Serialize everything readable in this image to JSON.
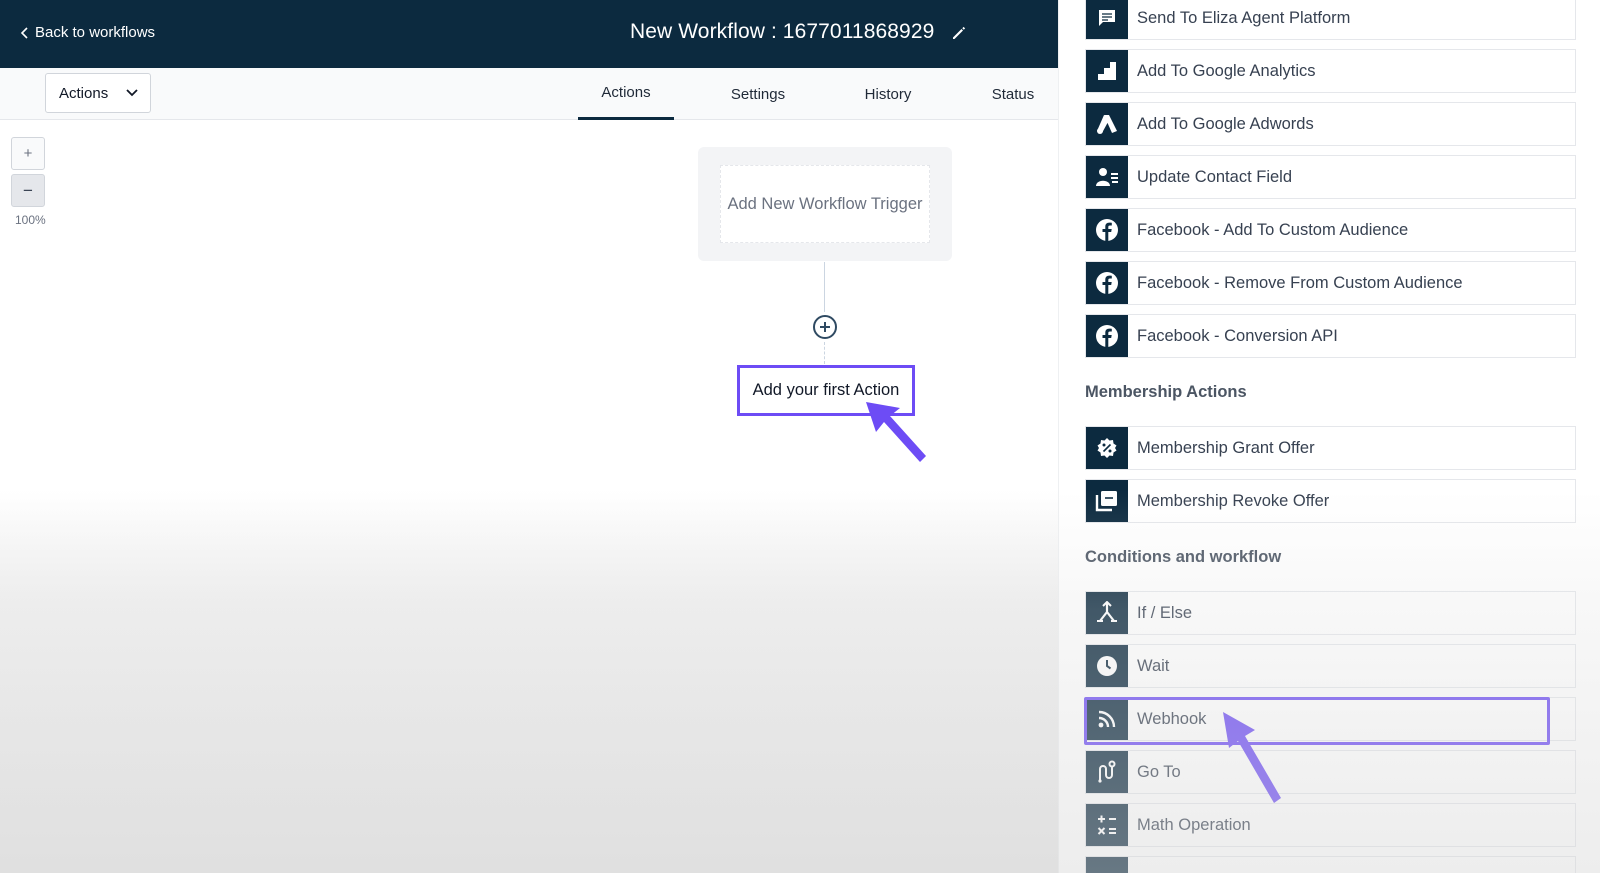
{
  "header": {
    "back_label": "Back to workflows",
    "title": "New Workflow : 1677011868929",
    "edit_icon": "pencil-icon"
  },
  "toolbar": {
    "actions_dropdown": "Actions",
    "tabs": [
      {
        "label": "Actions",
        "active": true
      },
      {
        "label": "Settings",
        "active": false
      },
      {
        "label": "History",
        "active": false
      },
      {
        "label": "Status",
        "active": false
      }
    ]
  },
  "canvas": {
    "zoom_in": "+",
    "zoom_out": "−",
    "zoom_level": "100%",
    "trigger_placeholder": "Add New Workflow Trigger",
    "first_action": "Add your first Action"
  },
  "panel": {
    "items_top": [
      {
        "label": "Send To Eliza Agent Platform",
        "icon": "chat-icon"
      },
      {
        "label": "Add To Google Analytics",
        "icon": "analytics-icon"
      },
      {
        "label": "Add To Google Adwords",
        "icon": "adwords-icon"
      },
      {
        "label": "Update Contact Field",
        "icon": "contact-card-icon"
      },
      {
        "label": "Facebook - Add To Custom Audience",
        "icon": "facebook-icon"
      },
      {
        "label": "Facebook - Remove From Custom Audience",
        "icon": "facebook-icon"
      },
      {
        "label": "Facebook - Conversion API",
        "icon": "facebook-icon"
      }
    ],
    "membership_title": "Membership Actions",
    "membership_items": [
      {
        "label": "Membership Grant Offer",
        "icon": "discount-badge-icon"
      },
      {
        "label": "Membership Revoke Offer",
        "icon": "copy-stack-icon"
      }
    ],
    "conditions_title": "Conditions and workflow",
    "conditions_items": [
      {
        "label": "If / Else",
        "icon": "branch-icon"
      },
      {
        "label": "Wait",
        "icon": "clock-icon"
      },
      {
        "label": "Webhook",
        "icon": "rss-icon",
        "highlighted": true
      },
      {
        "label": "Go To",
        "icon": "route-icon"
      },
      {
        "label": "Math Operation",
        "icon": "math-icon"
      }
    ]
  },
  "colors": {
    "header_bg": "#0c2a3f",
    "highlight": "#6d4cf5",
    "icon_bg": "#0c2a3f"
  }
}
